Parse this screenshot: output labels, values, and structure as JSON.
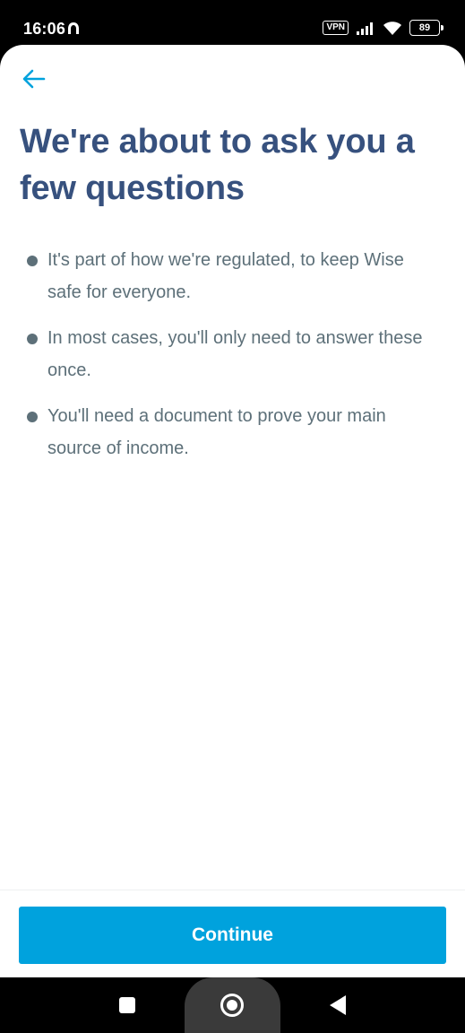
{
  "status_bar": {
    "time": "16:06",
    "vpn_label": "VPN",
    "battery_level": "89"
  },
  "header": {
    "title": "We're about to ask you a few questions"
  },
  "bullets": [
    "It's part of how we're regulated, to keep Wise safe for everyone.",
    "In most cases, you'll only need to answer these once.",
    "You'll need a document to prove your main source of income."
  ],
  "footer": {
    "continue_label": "Continue"
  },
  "colors": {
    "title": "#37517e",
    "body_text": "#5d7079",
    "primary": "#00a2dd",
    "back_arrow": "#00a2dd"
  },
  "icons": {
    "back": "arrow-left-icon",
    "notification": "notification-icon",
    "signal": "signal-icon",
    "wifi": "wifi-icon",
    "battery": "battery-icon"
  }
}
